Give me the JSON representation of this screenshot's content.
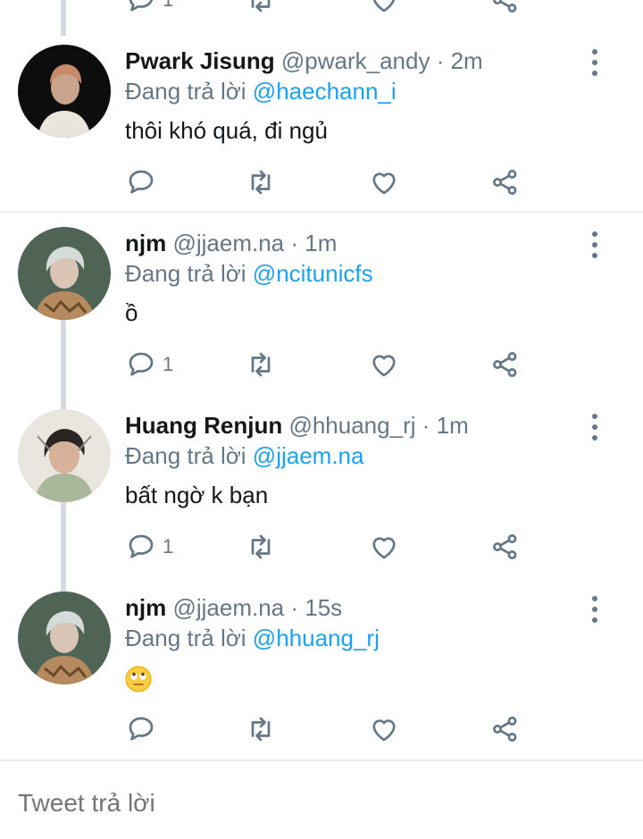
{
  "tweets": [
    {
      "name": "Pwark Jisung",
      "handle": "@pwark_andy",
      "time": "· 2m",
      "reply_prefix": "Đang trả lời",
      "reply_to": "@haechann_i",
      "text": "thôi khó quá, đi ngủ",
      "reply_count": ""
    },
    {
      "name": "njm",
      "handle": "@jjaem.na",
      "time": "· 1m",
      "reply_prefix": "Đang trả lời",
      "reply_to": "@ncitunicfs",
      "text": "ồ",
      "reply_count": "1"
    },
    {
      "name": "Huang Renjun",
      "handle": "@hhuang_rj",
      "time": "· 1m",
      "reply_prefix": "Đang trả lời",
      "reply_to": "@jjaem.na",
      "text": "bất ngờ k bạn",
      "reply_count": "1"
    },
    {
      "name": "njm",
      "handle": "@jjaem.na",
      "time": "· 15s",
      "reply_prefix": "Đang trả lời",
      "reply_to": "@hhuang_rj",
      "text": "",
      "emoji": "eye-roll-emoji",
      "reply_count": ""
    }
  ],
  "top_partial": {
    "reply_count": "1"
  },
  "composer": {
    "placeholder": "Tweet trả lời"
  },
  "colors": {
    "accent": "#1da1f2",
    "muted": "#657786",
    "text": "#14171a",
    "line": "#d7dbdf"
  }
}
